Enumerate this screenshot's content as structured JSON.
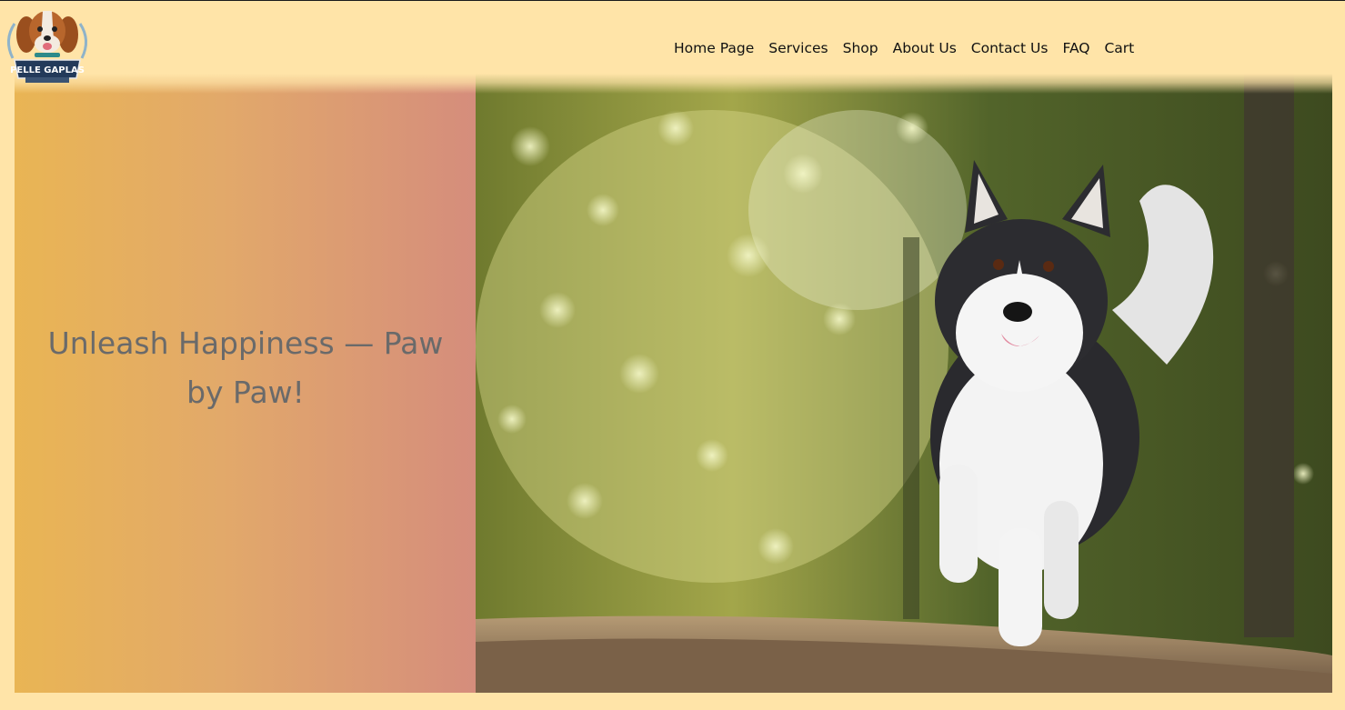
{
  "brand": {
    "logo_icon": "dog-mascot-logo",
    "logo_text": "PELLE GAPLAS"
  },
  "nav": {
    "items": [
      {
        "label": "Home Page"
      },
      {
        "label": "Services"
      },
      {
        "label": "Shop"
      },
      {
        "label": "About Us"
      },
      {
        "label": "Contact Us"
      },
      {
        "label": "FAQ"
      },
      {
        "label": "Cart"
      }
    ]
  },
  "hero": {
    "tagline": "Unleash Happiness — Paw by Paw!",
    "image_icon": "running-husky-photo"
  },
  "colors": {
    "page_background": "#ffe4a8",
    "gradient_start": "#e9b554",
    "gradient_end": "#d58d7c",
    "tagline_text": "#6a6a6a",
    "nav_text": "#111111"
  }
}
